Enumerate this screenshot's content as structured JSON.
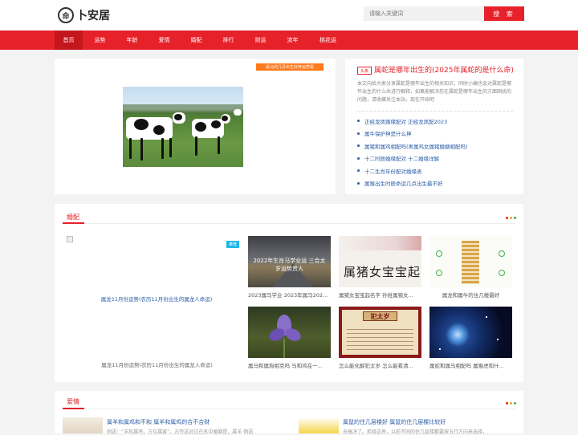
{
  "brand": {
    "name": "卜安居",
    "mark": "命"
  },
  "search": {
    "placeholder": "请输入关键词",
    "button": "搜 索"
  },
  "nav": [
    "首页",
    "运势",
    "年龄",
    "爱情",
    "婚配",
    "排行",
    "财运",
    "流年",
    "桃花运"
  ],
  "hero": {
    "tag": "属马的几月出生好养运势属"
  },
  "headline": {
    "tag": "头条",
    "title": "属蛇是哪年出生的(2025年属蛇的是什么命)",
    "desc": "本文向给大家分享属蛇是哪年出生的相关知识，同时小编也会对属蛇是哪年出生的什么命进行解释，如果能解决您在属蛇是哪年出生的方面困扰的问题，请收藏关注本站，现在开始吧",
    "links": [
      "正经龙凤婚缘配对 正经龙凤配2023",
      "属牛保护神是什么神",
      "属猪和属鸡相配吗(男属鸡女属猪婚姻相配吗)",
      "十二时辰婚缘配对 十二婚缘详解",
      "十二生肖年份配对婚缘表",
      "属猴出生时辰命运几点出生最不好"
    ]
  },
  "hunpei": {
    "title": "婚配",
    "badge": "推荐",
    "big_link": "属龙11月份运势(农历11月份出生的属龙人命运)",
    "big_caption": "属龙11月份运势(农历11月份出生的属龙人命运)",
    "thumbs": [
      {
        "overlay": "2022年生肖马学业运 三合太岁运势贵人",
        "caption": "2023属马学业 2023年属马2023..."
      },
      {
        "overlay": "属猪女宝宝起名字",
        "caption": "属猪女宝宝起名字 孙姓属猪女..."
      },
      {
        "overlay": "",
        "caption": "属龙和属牛的住几楼最好"
      },
      {
        "overlay": "",
        "caption": "属马和属狗相克吗 马和鸡在一..."
      },
      {
        "overlay": "犯太岁",
        "caption": "怎么能化解犯太岁 怎么能看清..."
      },
      {
        "overlay": "",
        "caption": "属蛇和属马相配吗 属猴虎和什..."
      }
    ]
  },
  "aiqing": {
    "title": "爱情",
    "items": [
      {
        "title": "属羊和属鸡和不和 属羊和属鸡的合不合财",
        "desc": "例语：“羊和属鸡，方位属害”。古传这对过在名中婚姻是，属羊 例语"
      },
      {
        "title": "属鼠的住几层楼好 属鼠的住几层楼比较好",
        "desc": "去搞决了。担择这养，以前不同的住几层楼都要按五行方向来选择，"
      }
    ]
  },
  "colors": {
    "accent": "#e62129",
    "accent_dark": "#c4161d",
    "link": "#2a5ca8",
    "tag_orange": "#ff7a1c",
    "badge_blue": "#1fb6e8"
  },
  "icons": [
    "logo-icon",
    "broken-image-icon",
    "section-dots-icon"
  ]
}
